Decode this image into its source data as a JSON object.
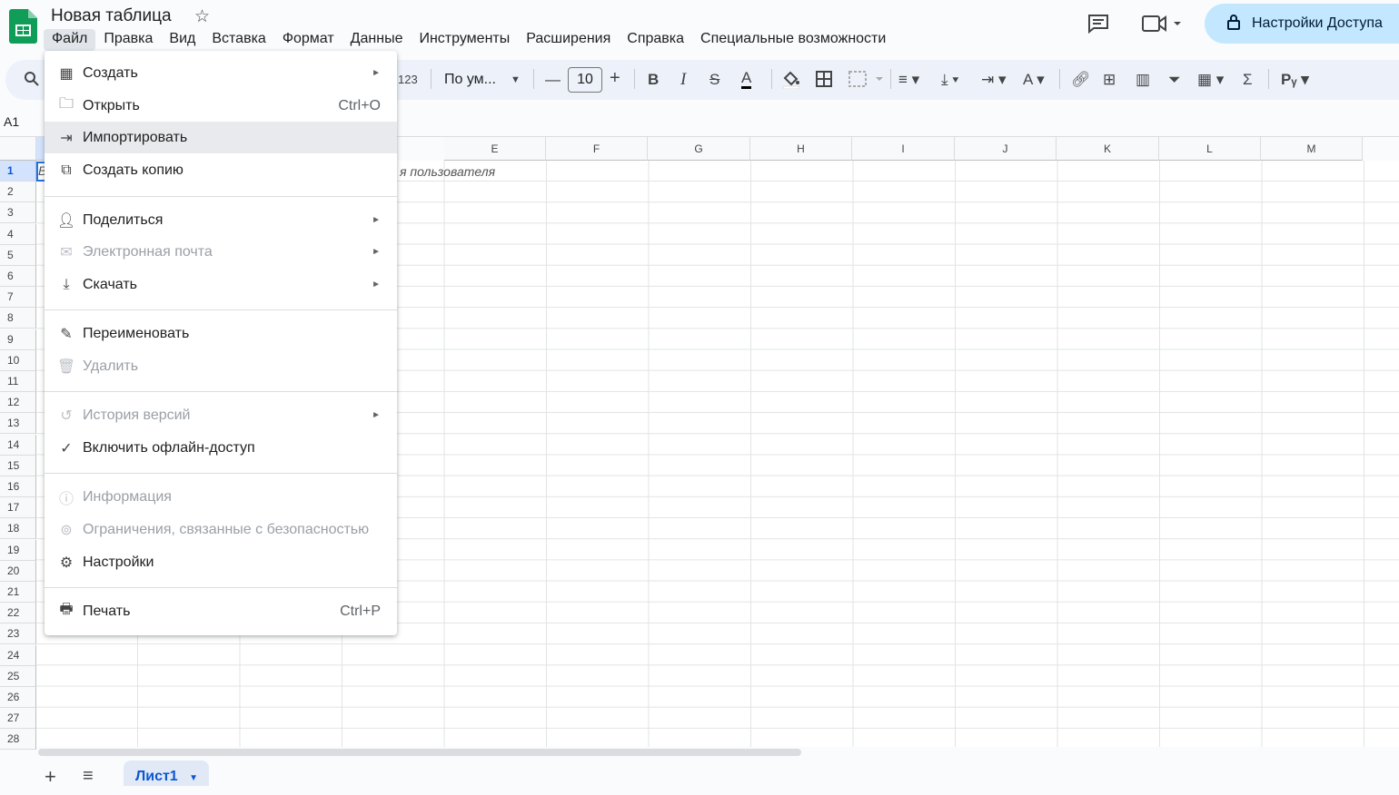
{
  "app": {
    "title": "Новая таблица"
  },
  "menubar": [
    "Файл",
    "Правка",
    "Вид",
    "Вставка",
    "Формат",
    "Данные",
    "Инструменты",
    "Расширения",
    "Справка",
    "Специальные возможности"
  ],
  "share": {
    "label": "Настройки Доступа"
  },
  "toolbar": {
    "format_123": "123",
    "font_name": "По ум...",
    "font_size": "10"
  },
  "namebox": "A1",
  "columns": [
    "E",
    "F",
    "G",
    "H",
    "I",
    "J",
    "K",
    "L",
    "M"
  ],
  "rows": [
    "1",
    "2",
    "3",
    "4",
    "5",
    "6",
    "7",
    "8",
    "9",
    "10",
    "11",
    "12",
    "13",
    "14",
    "15",
    "16",
    "17",
    "18",
    "19",
    "20",
    "21",
    "22",
    "23",
    "24",
    "25",
    "26",
    "27",
    "28"
  ],
  "cell_visible_text": "я пользователя",
  "cell_a1_fragment": "В",
  "sheet_tab": "Лист1",
  "file_menu": {
    "items": [
      {
        "label": "Создать",
        "shortcut": "",
        "submenu": true,
        "icon": "spreadsheet-add-icon",
        "disabled": false
      },
      {
        "label": "Открыть",
        "shortcut": "Ctrl+O",
        "submenu": false,
        "icon": "folder-icon",
        "disabled": false
      },
      {
        "label": "Импортировать",
        "shortcut": "",
        "submenu": false,
        "icon": "import-icon",
        "disabled": false,
        "highlighted": true
      },
      {
        "label": "Создать копию",
        "shortcut": "",
        "submenu": false,
        "icon": "copy-icon",
        "disabled": false
      },
      {
        "label": "Поделиться",
        "shortcut": "",
        "submenu": true,
        "icon": "share-person-icon",
        "disabled": false
      },
      {
        "label": "Электронная почта",
        "shortcut": "",
        "submenu": true,
        "icon": "mail-icon",
        "disabled": true
      },
      {
        "label": "Скачать",
        "shortcut": "",
        "submenu": true,
        "icon": "download-icon",
        "disabled": false
      },
      {
        "label": "Переименовать",
        "shortcut": "",
        "submenu": false,
        "icon": "pencil-icon",
        "disabled": false
      },
      {
        "label": "Удалить",
        "shortcut": "",
        "submenu": false,
        "icon": "trash-icon",
        "disabled": true
      },
      {
        "label": "История версий",
        "shortcut": "",
        "submenu": true,
        "icon": "history-icon",
        "disabled": true
      },
      {
        "label": "Включить офлайн-доступ",
        "shortcut": "",
        "submenu": false,
        "icon": "offline-check-icon",
        "disabled": false
      },
      {
        "label": "Информация",
        "shortcut": "",
        "submenu": false,
        "icon": "info-icon",
        "disabled": true
      },
      {
        "label": "Ограничения, связанные с безопасностью",
        "shortcut": "",
        "submenu": false,
        "icon": "security-icon",
        "disabled": true
      },
      {
        "label": "Настройки",
        "shortcut": "",
        "submenu": false,
        "icon": "gear-icon",
        "disabled": false
      },
      {
        "label": "Печать",
        "shortcut": "Ctrl+P",
        "submenu": false,
        "icon": "printer-icon",
        "disabled": false
      }
    ]
  }
}
